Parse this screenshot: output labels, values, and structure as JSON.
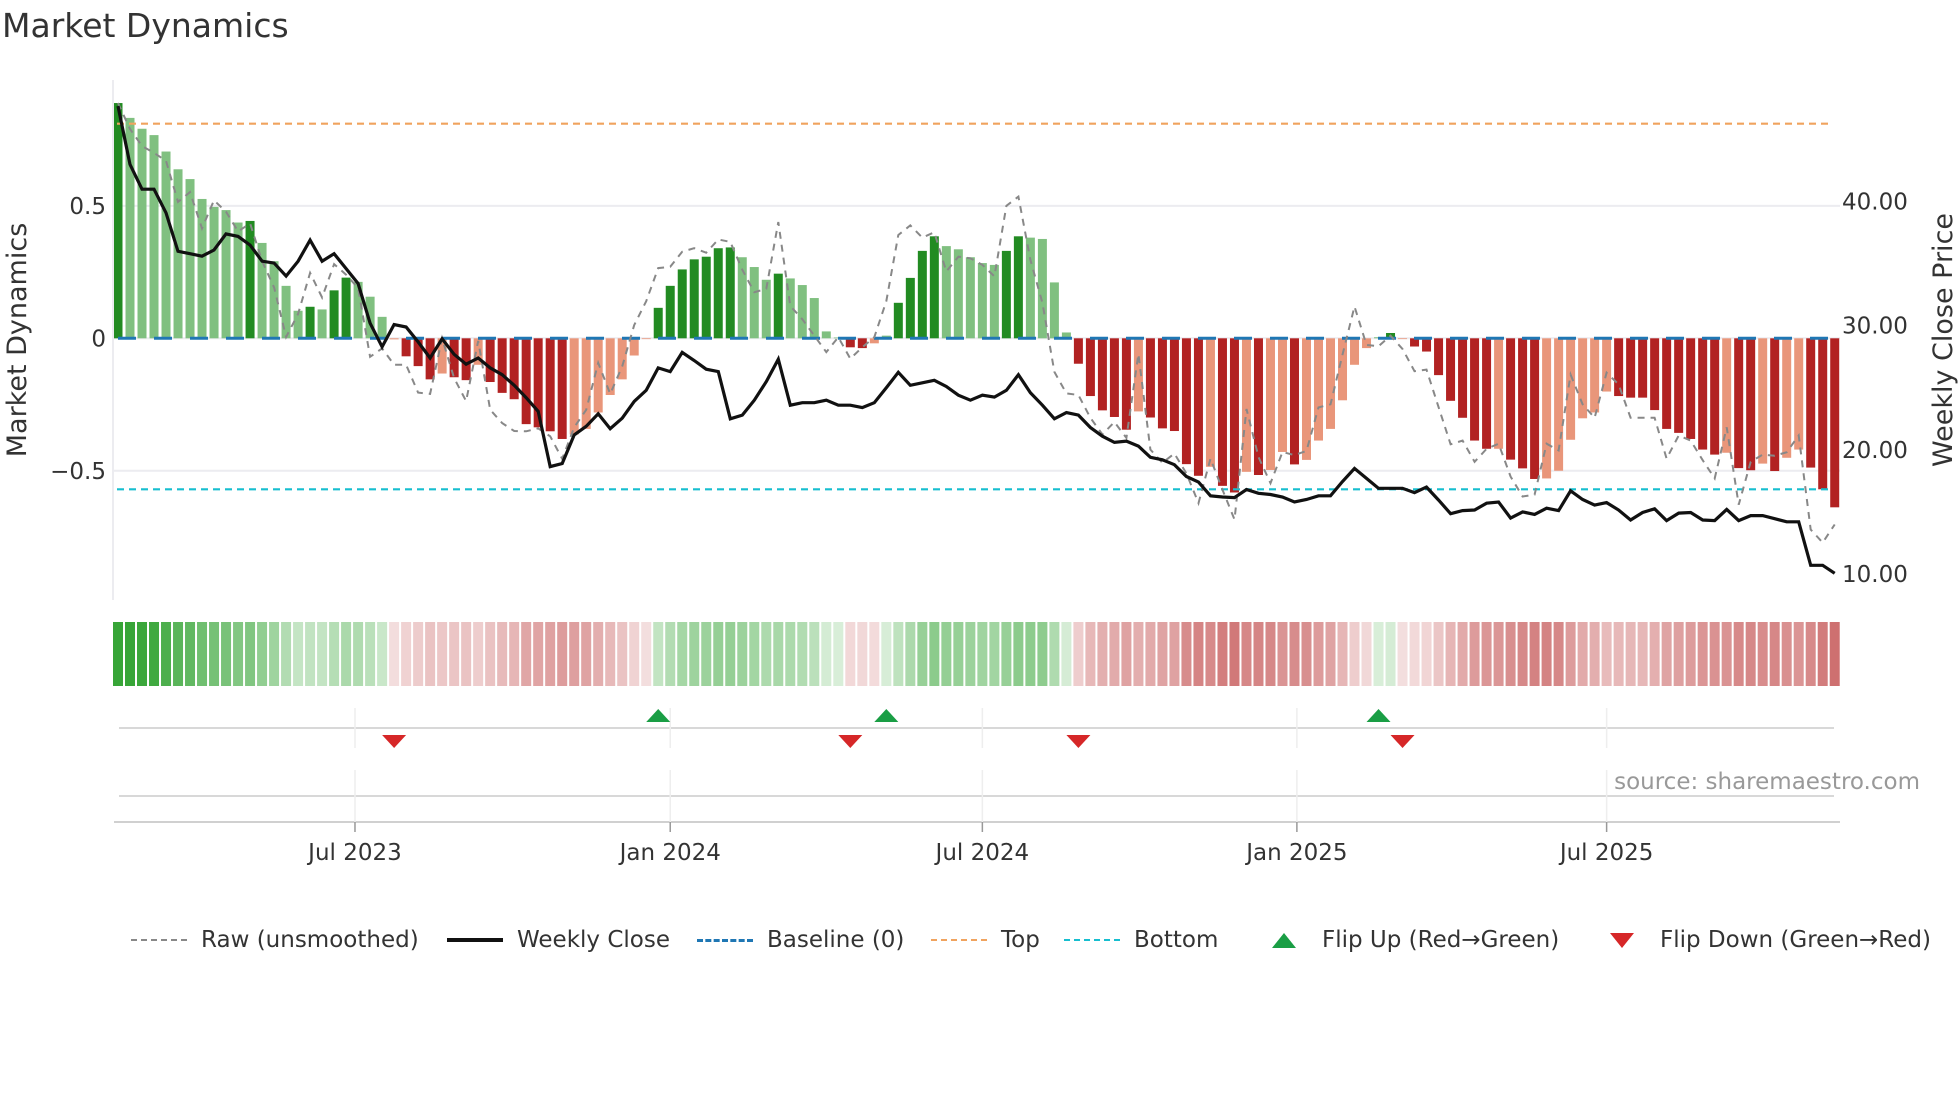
{
  "chart_data": {
    "type": "bar",
    "title": "Market Dynamics",
    "ylabel": "Market Dynamics",
    "ylabel_right": "Weekly Close Price",
    "ylim": [
      -0.99,
      0.975
    ],
    "ylim_right": [
      7.9,
      49.8
    ],
    "yticks": [
      {
        "v": 0.5,
        "label": "0.5"
      },
      {
        "v": 0,
        "label": "0"
      },
      {
        "v": -0.5,
        "label": "−0.5"
      }
    ],
    "yticks_right": [
      {
        "v": 40,
        "label": "40.00"
      },
      {
        "v": 30,
        "label": "30.00"
      },
      {
        "v": 20,
        "label": "20.00"
      },
      {
        "v": 10,
        "label": "10.00"
      }
    ],
    "x_unit": "week index",
    "xticks": [
      {
        "w": 19.74,
        "label": "Jul 2023"
      },
      {
        "w": 46.0,
        "label": "Jan 2024"
      },
      {
        "w": 72.0,
        "label": "Jul 2024"
      },
      {
        "w": 98.2,
        "label": "Jan 2025"
      },
      {
        "w": 124.0,
        "label": "Jul 2025"
      }
    ],
    "top_level": 0.81,
    "bottom_level": -0.57,
    "baseline": 0,
    "bar_values": [
      0.888,
      0.832,
      0.791,
      0.767,
      0.705,
      0.638,
      0.601,
      0.526,
      0.496,
      0.484,
      0.437,
      0.443,
      0.36,
      0.291,
      0.198,
      0.104,
      0.119,
      0.109,
      0.181,
      0.229,
      0.213,
      0.157,
      0.081,
      -0.004,
      -0.068,
      -0.105,
      -0.155,
      -0.133,
      -0.147,
      -0.158,
      -0.1,
      -0.165,
      -0.206,
      -0.23,
      -0.324,
      -0.336,
      -0.351,
      -0.38,
      -0.363,
      -0.342,
      -0.28,
      -0.214,
      -0.155,
      -0.065,
      -0.003,
      0.115,
      0.198,
      0.26,
      0.298,
      0.308,
      0.34,
      0.343,
      0.306,
      0.269,
      0.221,
      0.244,
      0.226,
      0.201,
      0.152,
      0.026,
      0.003,
      -0.034,
      -0.037,
      -0.019,
      0.01,
      0.134,
      0.228,
      0.33,
      0.385,
      0.348,
      0.336,
      0.306,
      0.284,
      0.277,
      0.33,
      0.385,
      0.38,
      0.375,
      0.211,
      0.022,
      -0.096,
      -0.218,
      -0.272,
      -0.297,
      -0.345,
      -0.276,
      -0.299,
      -0.34,
      -0.35,
      -0.475,
      -0.519,
      -0.485,
      -0.557,
      -0.582,
      -0.504,
      -0.516,
      -0.497,
      -0.429,
      -0.476,
      -0.459,
      -0.386,
      -0.342,
      -0.234,
      -0.1,
      -0.037,
      0.004,
      0.02,
      -0.003,
      -0.031,
      -0.05,
      -0.139,
      -0.236,
      -0.3,
      -0.386,
      -0.417,
      -0.417,
      -0.458,
      -0.491,
      -0.531,
      -0.529,
      -0.5,
      -0.383,
      -0.302,
      -0.28,
      -0.201,
      -0.218,
      -0.224,
      -0.224,
      -0.271,
      -0.342,
      -0.357,
      -0.38,
      -0.42,
      -0.439,
      -0.432,
      -0.49,
      -0.498,
      -0.473,
      -0.501,
      -0.451,
      -0.42,
      -0.488,
      -0.57,
      -0.638
    ],
    "bar_shades": "GggggggggggGggggGgGGgggrRRRrRRrRRRRRRRrrrrrrrGGGGGGGgggGgggggRRrgGGGGgggggGGggggRRRRRrRRRRRrRRrRrrRrrrrrrgGrRRRRRRRrRRRrrrrrrRRRRRRRRRrRRrRrrRRR",
    "raw_values": [
      0.888,
      0.79,
      0.726,
      0.7,
      0.67,
      0.515,
      0.552,
      0.415,
      0.521,
      0.478,
      0.403,
      0.434,
      0.291,
      0.192,
      0.005,
      0.092,
      0.247,
      0.154,
      0.28,
      0.24,
      0.19,
      -0.07,
      -0.038,
      -0.1,
      -0.1,
      -0.205,
      -0.21,
      0.0,
      -0.15,
      -0.237,
      -0.01,
      -0.27,
      -0.32,
      -0.35,
      -0.351,
      -0.34,
      -0.37,
      -0.455,
      -0.336,
      -0.27,
      -0.093,
      -0.21,
      -0.106,
      0.05,
      0.14,
      0.265,
      0.27,
      0.327,
      0.34,
      0.323,
      0.373,
      0.364,
      0.259,
      0.174,
      0.187,
      0.439,
      0.122,
      0.072,
      0.01,
      -0.052,
      0.004,
      -0.077,
      -0.034,
      0.004,
      0.14,
      0.39,
      0.426,
      0.38,
      0.4,
      0.252,
      0.308,
      0.302,
      0.277,
      0.234,
      0.5,
      0.535,
      0.296,
      0.134,
      -0.127,
      -0.208,
      -0.214,
      -0.3,
      -0.363,
      -0.316,
      -0.376,
      -0.059,
      -0.42,
      -0.47,
      -0.435,
      -0.51,
      -0.622,
      -0.454,
      -0.572,
      -0.684,
      -0.267,
      -0.448,
      -0.547,
      -0.429,
      -0.441,
      -0.425,
      -0.261,
      -0.249,
      -0.062,
      0.12,
      -0.025,
      -0.03,
      0.01,
      -0.04,
      -0.124,
      -0.118,
      -0.26,
      -0.4,
      -0.386,
      -0.466,
      -0.417,
      -0.398,
      -0.522,
      -0.597,
      -0.59,
      -0.398,
      -0.423,
      -0.137,
      -0.249,
      -0.3,
      -0.13,
      -0.174,
      -0.3,
      -0.3,
      -0.3,
      -0.454,
      -0.367,
      -0.386,
      -0.46,
      -0.529,
      -0.336,
      -0.628,
      -0.466,
      -0.439,
      -0.443,
      -0.43,
      -0.367,
      -0.722,
      -0.771,
      -0.703
    ],
    "close_values": [
      47.7,
      43.0,
      41.0,
      41.0,
      39.1,
      36.0,
      35.8,
      35.6,
      36.1,
      37.4,
      37.2,
      36.5,
      35.2,
      35.05,
      34.0,
      35.2,
      36.9,
      35.2,
      35.8,
      34.6,
      33.4,
      30.2,
      28.3,
      30.1,
      29.9,
      28.7,
      27.4,
      28.95,
      27.7,
      26.9,
      27.4,
      26.6,
      26.05,
      25.2,
      24.2,
      23.1,
      18.65,
      18.9,
      21.2,
      21.9,
      22.9,
      21.7,
      22.55,
      23.9,
      24.8,
      26.6,
      26.3,
      27.85,
      27.2,
      26.5,
      26.3,
      22.5,
      22.8,
      24.0,
      25.5,
      27.3,
      23.6,
      23.8,
      23.8,
      24.0,
      23.6,
      23.6,
      23.4,
      23.8,
      25.0,
      26.25,
      25.2,
      25.4,
      25.6,
      25.1,
      24.4,
      24.0,
      24.4,
      24.25,
      24.8,
      26.05,
      24.6,
      23.6,
      22.5,
      23.0,
      22.8,
      21.8,
      21.1,
      20.6,
      20.7,
      20.3,
      19.4,
      19.2,
      18.8,
      17.85,
      17.4,
      16.3,
      16.2,
      16.15,
      16.8,
      16.5,
      16.4,
      16.2,
      15.8,
      16.0,
      16.3,
      16.3,
      17.45,
      18.5,
      17.7,
      16.9,
      16.9,
      16.9,
      16.55,
      17.0,
      15.95,
      14.85,
      15.1,
      15.15,
      15.7,
      15.8,
      14.5,
      15.0,
      14.8,
      15.3,
      15.1,
      16.7,
      16.0,
      15.55,
      15.75,
      15.15,
      14.35,
      14.95,
      15.25,
      14.3,
      14.9,
      14.95,
      14.35,
      14.3,
      15.2,
      14.3,
      14.7,
      14.7,
      14.45,
      14.2,
      14.2,
      10.7,
      10.7,
      10.05
    ],
    "flip_up_weeks": [
      45,
      64,
      105
    ],
    "flip_down_weeks": [
      23,
      61,
      80,
      107
    ],
    "colors": {
      "bar_dark_green": "#228b22",
      "bar_light_green": "#80c080",
      "bar_dark_red": "#b22222",
      "bar_light_red": "#e9967a",
      "raw": "#888888",
      "close": "#111111",
      "baseline": "#1f77b4",
      "top": "#f0a35e",
      "bottom": "#17becf",
      "flip_up": "#1a9e45",
      "flip_down": "#d62728",
      "strip_green": "#2ca02c",
      "strip_red": "#c04848"
    },
    "legend": [
      {
        "label": "Raw (unsmoothed)",
        "key": "raw"
      },
      {
        "label": "Weekly Close",
        "key": "close"
      },
      {
        "label": "Baseline (0)",
        "key": "baseline"
      },
      {
        "label": "Top",
        "key": "top"
      },
      {
        "label": "Bottom",
        "key": "bottom"
      },
      {
        "label": "Flip Up (Red→Green)",
        "key": "flip_up"
      },
      {
        "label": "Flip Down (Green→Red)",
        "key": "flip_down"
      }
    ],
    "legend_position": "bottom",
    "source": "source: sharemaestro.com"
  }
}
